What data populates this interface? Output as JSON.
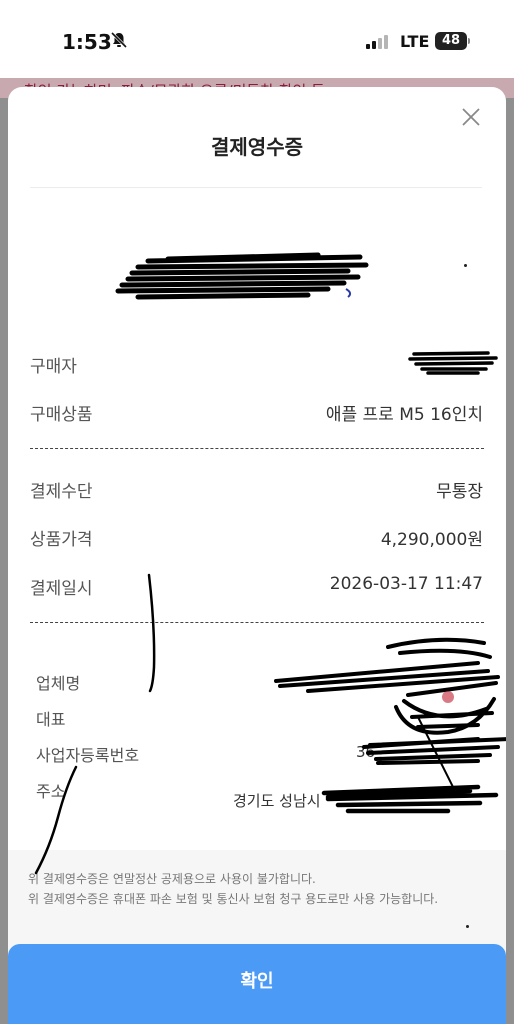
{
  "status_bar": {
    "time": "1:53",
    "network": "LTE",
    "battery": "48"
  },
  "background_page": {
    "partial_text": "확인 가능하며, 파손/무관한 오류/미동착 확인 등"
  },
  "receipt": {
    "title": "결제영수증",
    "rows": [
      {
        "label": "구매자",
        "value": ""
      },
      {
        "label": "구매상품",
        "value": "애플 프로 M5 16인치"
      },
      {
        "label": "결제수단",
        "value": "무통장"
      },
      {
        "label": "상품가격",
        "value": "4,290,000원"
      },
      {
        "label": "결제일시",
        "value": "2026-03-17 11:47"
      }
    ],
    "business": {
      "company_label": "업체명",
      "rep_label": "대표",
      "reg_label": "사업자등록번호",
      "reg_value_partial": "36",
      "address_label": "주소",
      "address_value_partial": "경기도 성남시"
    },
    "notices": [
      "위 결제영수증은 연말정산 공제용으로 사용이 불가합니다.",
      "위 결제영수증은 휴대폰 파손 보험 및 통신사 보험 청구 용도로만 사용 가능합니다."
    ],
    "confirm_label": "확인"
  },
  "colors": {
    "accent": "#4b9af5",
    "scribble": "#000000"
  },
  "icons": {
    "close": "close-icon",
    "bell": "bell-slash-icon"
  }
}
